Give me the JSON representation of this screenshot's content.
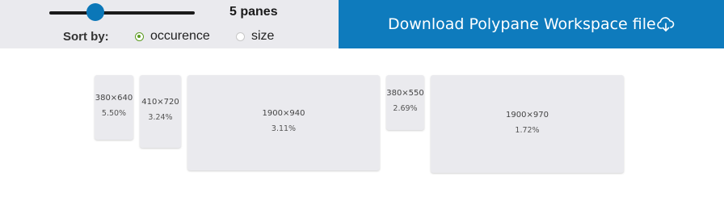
{
  "controls": {
    "pane_count": "5 panes",
    "slider_value": 0.35,
    "sort_label": "Sort by:",
    "sort_options": [
      {
        "label": "occurence",
        "selected": true
      },
      {
        "label": "size",
        "selected": false
      }
    ]
  },
  "download": {
    "label": "Download Polypane Workspace file",
    "icon": "cloud-download-icon"
  },
  "panes": [
    {
      "dims": "380×640",
      "pct": "5.50%"
    },
    {
      "dims": "410×720",
      "pct": "3.24%"
    },
    {
      "dims": "1900×940",
      "pct": "3.11%"
    },
    {
      "dims": "380×550",
      "pct": "2.69%"
    },
    {
      "dims": "1900×970",
      "pct": "1.72%"
    }
  ],
  "colors": {
    "accent_blue": "#0e7bbd",
    "slider_thumb": "#0b77b8",
    "radio_selected": "#5c9b20",
    "panel_bg": "#eaeaee"
  }
}
